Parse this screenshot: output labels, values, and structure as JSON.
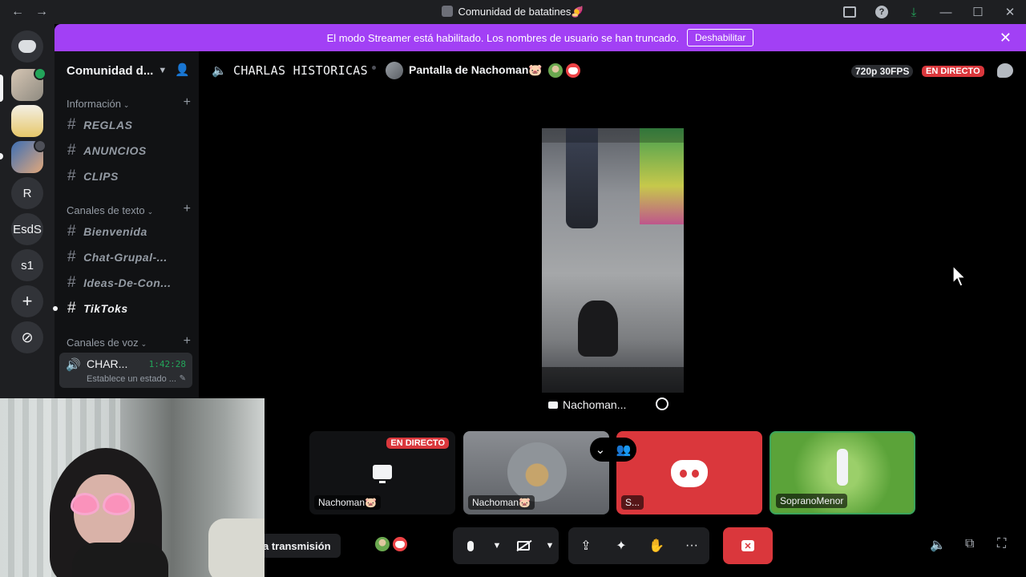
{
  "window": {
    "title": "Comunidad de batatines🍠",
    "nav_back": "←",
    "nav_forward": "→"
  },
  "banner": {
    "message": "El modo Streamer está habilitado. Los nombres de usuario se han truncado.",
    "button": "Deshabilitar",
    "close": "✕"
  },
  "servers": [
    {
      "label": "",
      "icon": "discord-home-icon"
    },
    {
      "label": "",
      "icon": "server-avatar"
    },
    {
      "label": "",
      "icon": "server-avatar"
    },
    {
      "label": "",
      "icon": "server-avatar"
    },
    {
      "label": "R"
    },
    {
      "label": "EsdS"
    },
    {
      "label": "s1"
    },
    {
      "label": "+",
      "icon": "add-server-icon"
    },
    {
      "label": "⊘",
      "icon": "explore-icon"
    }
  ],
  "sidebar": {
    "server_name": "Comunidad d...",
    "categories": [
      {
        "label": "Información",
        "channels": [
          "REGLAS",
          "ANUNCIOS",
          "CLIPS"
        ]
      },
      {
        "label": "Canales de texto",
        "channels": [
          "Bienvenida",
          "Chat-Grupal-...",
          "Ideas-De-Con...",
          "TikToks"
        ]
      },
      {
        "label": "Canales de voz"
      }
    ],
    "voice_channel": {
      "name": "CHAR...",
      "time": "1:42:28",
      "status": "Establece un estado ..."
    }
  },
  "header": {
    "channel": "CHARLAS HISTORICAS",
    "stream_title": "Pantalla de Nachoman🐷",
    "quality": "720p 30FPS",
    "live": "EN DIRECTO"
  },
  "stream": {
    "label": "Nachoman..."
  },
  "tiles": [
    {
      "name": "Nachoman🐷",
      "badge": "EN DIRECTO",
      "type": "screen"
    },
    {
      "name": "Nachoman🐷",
      "type": "phone"
    },
    {
      "name": "S...",
      "type": "discord"
    },
    {
      "name": "SopranoMenor",
      "type": "video"
    }
  ],
  "controls": {
    "transmission_label": "a transmisión",
    "more": "···"
  },
  "colors": {
    "banner": "#a240f5",
    "live": "#da373c",
    "speaking": "#23a55a",
    "leave": "#da373c"
  }
}
